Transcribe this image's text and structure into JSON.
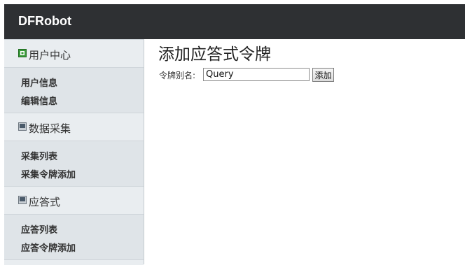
{
  "header": {
    "brand": "DFRobot"
  },
  "sidebar": {
    "sections": [
      {
        "title": "用户中心",
        "items": [
          "用户信息",
          "编辑信息"
        ]
      },
      {
        "title": "数据采集",
        "items": [
          "采集列表",
          "采集令牌添加"
        ]
      },
      {
        "title": "应答式",
        "items": [
          "应答列表",
          "应答令牌添加"
        ]
      }
    ]
  },
  "main": {
    "title": "添加应答式令牌",
    "form": {
      "alias_label": "令牌别名:",
      "alias_value": "Query",
      "add_label": "添加"
    }
  },
  "colors": {
    "topbar": "#2e3033",
    "sidebar": "#dfe4e8",
    "icon_green": "#3a9a3a"
  }
}
